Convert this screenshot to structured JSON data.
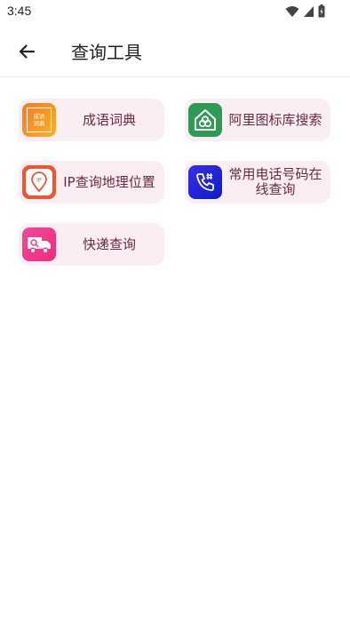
{
  "status_bar": {
    "time": "3:45"
  },
  "app_bar": {
    "title": "查询工具"
  },
  "tools": [
    {
      "label": "成语词典",
      "icon": "idiom-dictionary-icon",
      "icon_text": "成语词典"
    },
    {
      "label": "阿里图标库搜索",
      "icon": "alibaba-icon-library-icon"
    },
    {
      "label": "IP查询地理位置",
      "icon": "ip-location-icon",
      "icon_text": "IP"
    },
    {
      "label": "常用电话号码在线查询",
      "icon": "phone-lookup-icon"
    },
    {
      "label": "快递查询",
      "icon": "express-delivery-icon"
    }
  ],
  "colors": {
    "card_bg": "#fbeef2",
    "label": "#6b2b3a",
    "idiom_icon": "#f59a1e",
    "alibaba_icon": "#2f9a56",
    "ip_icon": "#f0552f",
    "phone_icon": "#1a2fe6",
    "express_icon": "#f23a8e"
  }
}
